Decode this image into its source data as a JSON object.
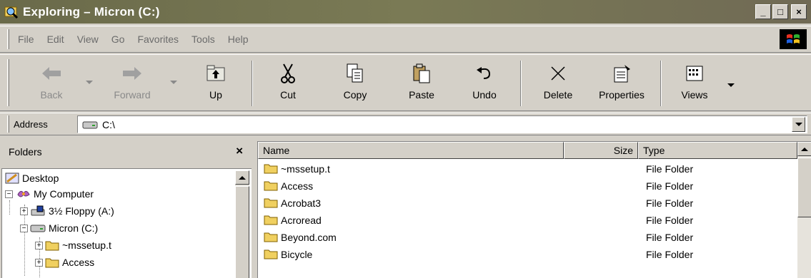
{
  "window": {
    "title": "Exploring – Micron (C:)",
    "controls": [
      "_",
      "□",
      "×"
    ]
  },
  "menu": [
    {
      "label": "File"
    },
    {
      "label": "Edit"
    },
    {
      "label": "View"
    },
    {
      "label": "Go"
    },
    {
      "label": "Favorites"
    },
    {
      "label": "Tools"
    },
    {
      "label": "Help"
    }
  ],
  "toolbar": {
    "back": "Back",
    "forward": "Forward",
    "up": "Up",
    "cut": "Cut",
    "copy": "Copy",
    "paste": "Paste",
    "undo": "Undo",
    "delete": "Delete",
    "properties": "Properties",
    "views": "Views"
  },
  "address": {
    "label": "Address",
    "value": "C:\\"
  },
  "folders_pane": {
    "title": "Folders",
    "close": "×",
    "tree": [
      {
        "label": "Desktop",
        "icon": "desktop-icon"
      },
      {
        "label": "My Computer",
        "icon": "my-computer-icon",
        "expander": "−"
      },
      {
        "label": "3½ Floppy (A:)",
        "icon": "floppy-drive-icon",
        "expander": "+"
      },
      {
        "label": "Micron (C:)",
        "icon": "hard-drive-icon",
        "expander": "−"
      },
      {
        "label": "~mssetup.t",
        "icon": "folder-icon",
        "expander": "+"
      },
      {
        "label": "Access",
        "icon": "folder-icon",
        "expander": "+"
      }
    ]
  },
  "file_list": {
    "columns": {
      "name": "Name",
      "size": "Size",
      "type": "Type"
    },
    "rows": [
      {
        "name": "~mssetup.t",
        "size": "",
        "type": "File Folder"
      },
      {
        "name": "Access",
        "size": "",
        "type": "File Folder"
      },
      {
        "name": "Acrobat3",
        "size": "",
        "type": "File Folder"
      },
      {
        "name": "Acroread",
        "size": "",
        "type": "File Folder"
      },
      {
        "name": "Beyond.com",
        "size": "",
        "type": "File Folder"
      },
      {
        "name": "Bicycle",
        "size": "",
        "type": "File Folder"
      }
    ]
  },
  "colors": {
    "titlebar": "#6a6a4a",
    "face": "#d4d0c8",
    "folder": "#f0d060"
  }
}
